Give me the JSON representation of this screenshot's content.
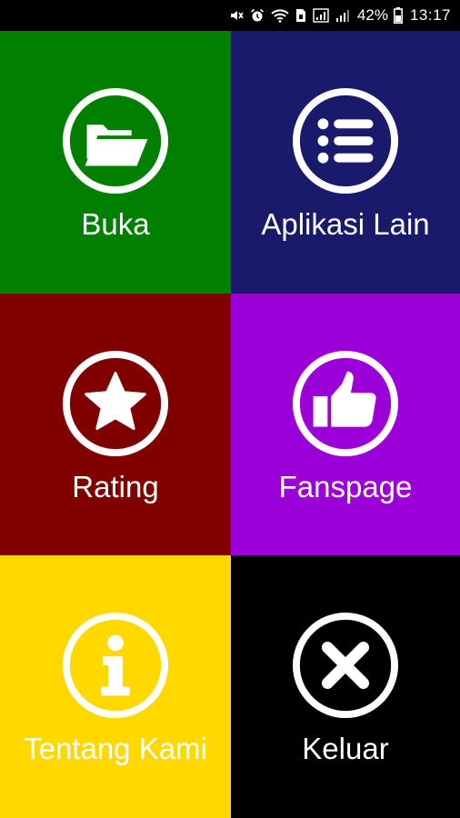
{
  "status_bar": {
    "battery_percent": "42%",
    "time": "13:17",
    "icons": [
      "mute-icon",
      "alarm-icon",
      "wifi-icon",
      "sim-icon",
      "signal-icon",
      "signal-icon-2",
      "battery-icon"
    ]
  },
  "menu": {
    "buka": {
      "label": "Buka",
      "icon": "folder-icon",
      "color": "#007f00"
    },
    "aplikasi_lain": {
      "label": "Aplikasi Lain",
      "icon": "list-icon",
      "color": "#1a1a6d"
    },
    "rating": {
      "label": "Rating",
      "icon": "star-icon",
      "color": "#800000"
    },
    "fanspage": {
      "label": "Fanspage",
      "icon": "thumbs-up-icon",
      "color": "#9b00d9"
    },
    "tentang_kami": {
      "label": "Tentang Kami",
      "icon": "info-icon",
      "color": "#ffd800"
    },
    "keluar": {
      "label": "Keluar",
      "icon": "close-icon",
      "color": "#000000"
    }
  }
}
